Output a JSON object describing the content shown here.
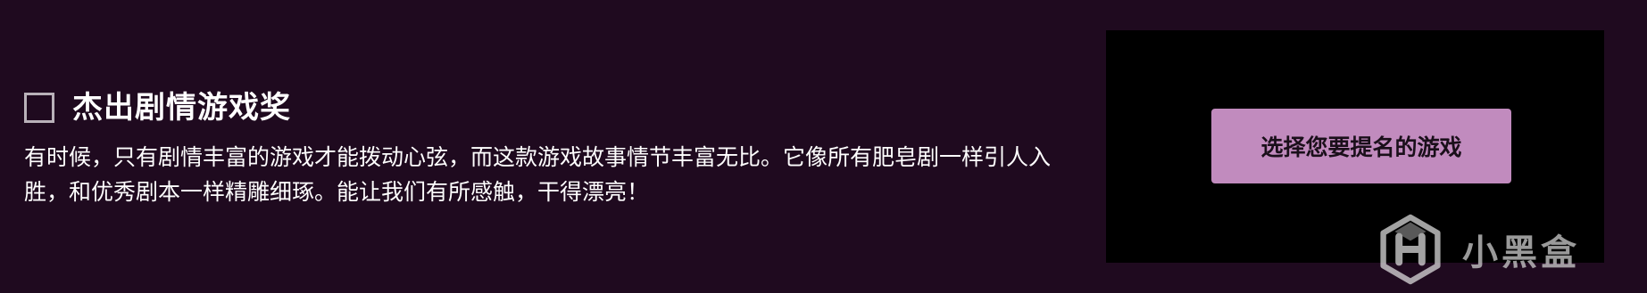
{
  "award": {
    "title": "杰出剧情游戏奖",
    "description": "有时候，只有剧情丰富的游戏才能拨动心弦，而这款游戏故事情节丰富无比。它像所有肥皂剧一样引人入胜，和优秀剧本一样精雕细琢。能让我们有所感触，干得漂亮！",
    "checked": false
  },
  "nominee_panel": {
    "button_label": "选择您要提名的游戏"
  },
  "watermark": {
    "text": "小黑盒",
    "icon": "heybox-logo-icon"
  },
  "colors": {
    "background": "#1f0a1f",
    "panel": "#000000",
    "button": "#c18bbe",
    "button_text": "#1a0f1a",
    "text": "#ffffff"
  }
}
